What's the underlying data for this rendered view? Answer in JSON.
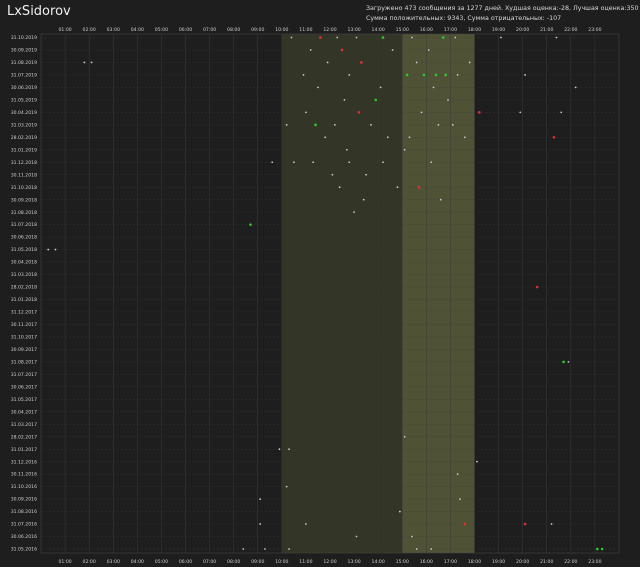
{
  "app": {
    "title": "LxSidorov"
  },
  "stats": {
    "line1": "Загружено 473 сообщения за 1277 дней. Худшая оценка:-28, Лучшая оценка:350",
    "line2": "Сумма положительных: 9343, Сумма отрицательных: -107"
  },
  "colors": {
    "background": "#1e1e1e",
    "grid": "#3a3a3a",
    "highlight_work": "#3c3f2a",
    "highlight_peak": "#5b5c3c",
    "positive": "#2ecc2e",
    "negative": "#e03030",
    "neutral": "#c8c8c8"
  },
  "chart_data": {
    "type": "scatter",
    "title": "",
    "xlabel": "",
    "ylabel": "",
    "x_ticks": [
      "01:00",
      "02:00",
      "03:00",
      "04:00",
      "05:00",
      "06:00",
      "07:00",
      "08:00",
      "09:00",
      "10:00",
      "11:00",
      "12:00",
      "13:00",
      "14:00",
      "15:00",
      "16:00",
      "17:00",
      "18:00",
      "19:00",
      "20:00",
      "21:00",
      "22:00",
      "23:00"
    ],
    "y_ticks": [
      "31.10.2019",
      "30.09.2019",
      "31.08.2019",
      "31.07.2019",
      "30.06.2019",
      "31.05.2019",
      "30.04.2019",
      "31.03.2019",
      "28.02.2019",
      "31.01.2019",
      "31.12.2018",
      "30.11.2018",
      "31.10.2018",
      "30.09.2018",
      "31.08.2018",
      "31.07.2018",
      "30.06.2018",
      "31.05.2018",
      "30.04.2018",
      "31.03.2018",
      "28.02.2018",
      "31.01.2018",
      "31.12.2017",
      "30.11.2017",
      "31.10.2017",
      "30.09.2017",
      "31.08.2017",
      "31.07.2017",
      "30.06.2017",
      "31.05.2017",
      "30.04.2017",
      "31.03.2017",
      "28.02.2017",
      "31.01.2017",
      "31.12.2016",
      "30.11.2016",
      "31.10.2016",
      "30.09.2016",
      "31.08.2016",
      "31.07.2016",
      "30.06.2016",
      "31.05.2016"
    ],
    "xlim": [
      0,
      24
    ],
    "highlight_bands": [
      {
        "from": 10,
        "to": 18,
        "shade": "work"
      },
      {
        "from": 15,
        "to": 18,
        "shade": "peak"
      }
    ],
    "points": [
      {
        "x": 10.4,
        "y": "31.10.2019",
        "kind": "neutral"
      },
      {
        "x": 11.6,
        "y": "31.10.2019",
        "kind": "negative"
      },
      {
        "x": 12.3,
        "y": "31.10.2019",
        "kind": "neutral"
      },
      {
        "x": 13.1,
        "y": "31.10.2019",
        "kind": "neutral"
      },
      {
        "x": 14.2,
        "y": "31.10.2019",
        "kind": "positive"
      },
      {
        "x": 15.4,
        "y": "31.10.2019",
        "kind": "neutral"
      },
      {
        "x": 16.7,
        "y": "31.10.2019",
        "kind": "positive"
      },
      {
        "x": 17.2,
        "y": "31.10.2019",
        "kind": "neutral"
      },
      {
        "x": 19.1,
        "y": "31.10.2019",
        "kind": "neutral"
      },
      {
        "x": 21.4,
        "y": "31.10.2019",
        "kind": "neutral"
      },
      {
        "x": 11.2,
        "y": "30.09.2019",
        "kind": "neutral"
      },
      {
        "x": 12.5,
        "y": "30.09.2019",
        "kind": "negative"
      },
      {
        "x": 14.6,
        "y": "30.09.2019",
        "kind": "neutral"
      },
      {
        "x": 16.1,
        "y": "30.09.2019",
        "kind": "neutral"
      },
      {
        "x": 1.8,
        "y": "31.08.2019",
        "kind": "neutral"
      },
      {
        "x": 2.1,
        "y": "31.08.2019",
        "kind": "neutral"
      },
      {
        "x": 11.9,
        "y": "31.08.2019",
        "kind": "neutral"
      },
      {
        "x": 13.3,
        "y": "31.08.2019",
        "kind": "negative"
      },
      {
        "x": 15.6,
        "y": "31.08.2019",
        "kind": "neutral"
      },
      {
        "x": 17.8,
        "y": "31.08.2019",
        "kind": "neutral"
      },
      {
        "x": 10.9,
        "y": "31.07.2019",
        "kind": "neutral"
      },
      {
        "x": 12.8,
        "y": "31.07.2019",
        "kind": "neutral"
      },
      {
        "x": 15.2,
        "y": "31.07.2019",
        "kind": "positive"
      },
      {
        "x": 15.9,
        "y": "31.07.2019",
        "kind": "positive"
      },
      {
        "x": 16.4,
        "y": "31.07.2019",
        "kind": "positive"
      },
      {
        "x": 16.8,
        "y": "31.07.2019",
        "kind": "positive"
      },
      {
        "x": 17.3,
        "y": "31.07.2019",
        "kind": "neutral"
      },
      {
        "x": 20.1,
        "y": "31.07.2019",
        "kind": "neutral"
      },
      {
        "x": 11.5,
        "y": "30.06.2019",
        "kind": "neutral"
      },
      {
        "x": 14.1,
        "y": "30.06.2019",
        "kind": "neutral"
      },
      {
        "x": 16.3,
        "y": "30.06.2019",
        "kind": "neutral"
      },
      {
        "x": 22.2,
        "y": "30.06.2019",
        "kind": "neutral"
      },
      {
        "x": 12.6,
        "y": "31.05.2019",
        "kind": "neutral"
      },
      {
        "x": 13.9,
        "y": "31.05.2019",
        "kind": "positive"
      },
      {
        "x": 16.9,
        "y": "31.05.2019",
        "kind": "neutral"
      },
      {
        "x": 11.0,
        "y": "30.04.2019",
        "kind": "neutral"
      },
      {
        "x": 13.2,
        "y": "30.04.2019",
        "kind": "negative"
      },
      {
        "x": 15.8,
        "y": "30.04.2019",
        "kind": "neutral"
      },
      {
        "x": 18.2,
        "y": "30.04.2019",
        "kind": "negative"
      },
      {
        "x": 19.9,
        "y": "30.04.2019",
        "kind": "neutral"
      },
      {
        "x": 21.6,
        "y": "30.04.2019",
        "kind": "neutral"
      },
      {
        "x": 10.2,
        "y": "31.03.2019",
        "kind": "neutral"
      },
      {
        "x": 11.4,
        "y": "31.03.2019",
        "kind": "positive"
      },
      {
        "x": 12.2,
        "y": "31.03.2019",
        "kind": "neutral"
      },
      {
        "x": 13.7,
        "y": "31.03.2019",
        "kind": "neutral"
      },
      {
        "x": 16.5,
        "y": "31.03.2019",
        "kind": "neutral"
      },
      {
        "x": 17.1,
        "y": "31.03.2019",
        "kind": "neutral"
      },
      {
        "x": 11.8,
        "y": "28.02.2019",
        "kind": "neutral"
      },
      {
        "x": 14.4,
        "y": "28.02.2019",
        "kind": "neutral"
      },
      {
        "x": 15.3,
        "y": "28.02.2019",
        "kind": "neutral"
      },
      {
        "x": 17.6,
        "y": "28.02.2019",
        "kind": "neutral"
      },
      {
        "x": 21.3,
        "y": "28.02.2019",
        "kind": "negative"
      },
      {
        "x": 12.7,
        "y": "31.01.2019",
        "kind": "neutral"
      },
      {
        "x": 15.1,
        "y": "31.01.2019",
        "kind": "neutral"
      },
      {
        "x": 9.6,
        "y": "31.12.2018",
        "kind": "neutral"
      },
      {
        "x": 10.5,
        "y": "31.12.2018",
        "kind": "neutral"
      },
      {
        "x": 11.3,
        "y": "31.12.2018",
        "kind": "neutral"
      },
      {
        "x": 12.8,
        "y": "31.12.2018",
        "kind": "neutral"
      },
      {
        "x": 14.2,
        "y": "31.12.2018",
        "kind": "neutral"
      },
      {
        "x": 16.2,
        "y": "31.12.2018",
        "kind": "neutral"
      },
      {
        "x": 12.1,
        "y": "30.11.2018",
        "kind": "neutral"
      },
      {
        "x": 13.5,
        "y": "30.11.2018",
        "kind": "neutral"
      },
      {
        "x": 15.7,
        "y": "31.10.2018",
        "kind": "negative"
      },
      {
        "x": 12.4,
        "y": "31.10.2018",
        "kind": "neutral"
      },
      {
        "x": 14.8,
        "y": "31.10.2018",
        "kind": "neutral"
      },
      {
        "x": 13.4,
        "y": "30.09.2018",
        "kind": "neutral"
      },
      {
        "x": 16.6,
        "y": "30.09.2018",
        "kind": "neutral"
      },
      {
        "x": 13.0,
        "y": "31.08.2018",
        "kind": "neutral"
      },
      {
        "x": 8.7,
        "y": "31.07.2018",
        "kind": "positive"
      },
      {
        "x": 0.3,
        "y": "31.05.2018",
        "kind": "neutral"
      },
      {
        "x": 0.6,
        "y": "31.05.2018",
        "kind": "neutral"
      },
      {
        "x": 20.6,
        "y": "28.02.2018",
        "kind": "negative"
      },
      {
        "x": 21.7,
        "y": "31.08.2017",
        "kind": "positive"
      },
      {
        "x": 21.9,
        "y": "31.08.2017",
        "kind": "neutral"
      },
      {
        "x": 15.1,
        "y": "28.02.2017",
        "kind": "neutral"
      },
      {
        "x": 9.9,
        "y": "31.01.2017",
        "kind": "neutral"
      },
      {
        "x": 10.3,
        "y": "31.01.2017",
        "kind": "neutral"
      },
      {
        "x": 18.1,
        "y": "31.12.2016",
        "kind": "neutral"
      },
      {
        "x": 17.3,
        "y": "30.11.2016",
        "kind": "neutral"
      },
      {
        "x": 10.2,
        "y": "31.10.2016",
        "kind": "neutral"
      },
      {
        "x": 9.1,
        "y": "30.09.2016",
        "kind": "neutral"
      },
      {
        "x": 17.4,
        "y": "30.09.2016",
        "kind": "neutral"
      },
      {
        "x": 14.9,
        "y": "31.08.2016",
        "kind": "neutral"
      },
      {
        "x": 9.1,
        "y": "31.07.2016",
        "kind": "neutral"
      },
      {
        "x": 11.0,
        "y": "31.07.2016",
        "kind": "neutral"
      },
      {
        "x": 17.6,
        "y": "31.07.2016",
        "kind": "negative"
      },
      {
        "x": 20.1,
        "y": "31.07.2016",
        "kind": "negative"
      },
      {
        "x": 21.2,
        "y": "31.07.2016",
        "kind": "neutral"
      },
      {
        "x": 13.1,
        "y": "30.06.2016",
        "kind": "neutral"
      },
      {
        "x": 15.4,
        "y": "30.06.2016",
        "kind": "neutral"
      },
      {
        "x": 8.4,
        "y": "31.05.2016",
        "kind": "neutral"
      },
      {
        "x": 9.3,
        "y": "31.05.2016",
        "kind": "neutral"
      },
      {
        "x": 10.3,
        "y": "31.05.2016",
        "kind": "neutral"
      },
      {
        "x": 15.6,
        "y": "31.05.2016",
        "kind": "neutral"
      },
      {
        "x": 16.2,
        "y": "31.05.2016",
        "kind": "neutral"
      },
      {
        "x": 23.1,
        "y": "31.05.2016",
        "kind": "positive"
      },
      {
        "x": 23.3,
        "y": "31.05.2016",
        "kind": "positive"
      }
    ]
  }
}
